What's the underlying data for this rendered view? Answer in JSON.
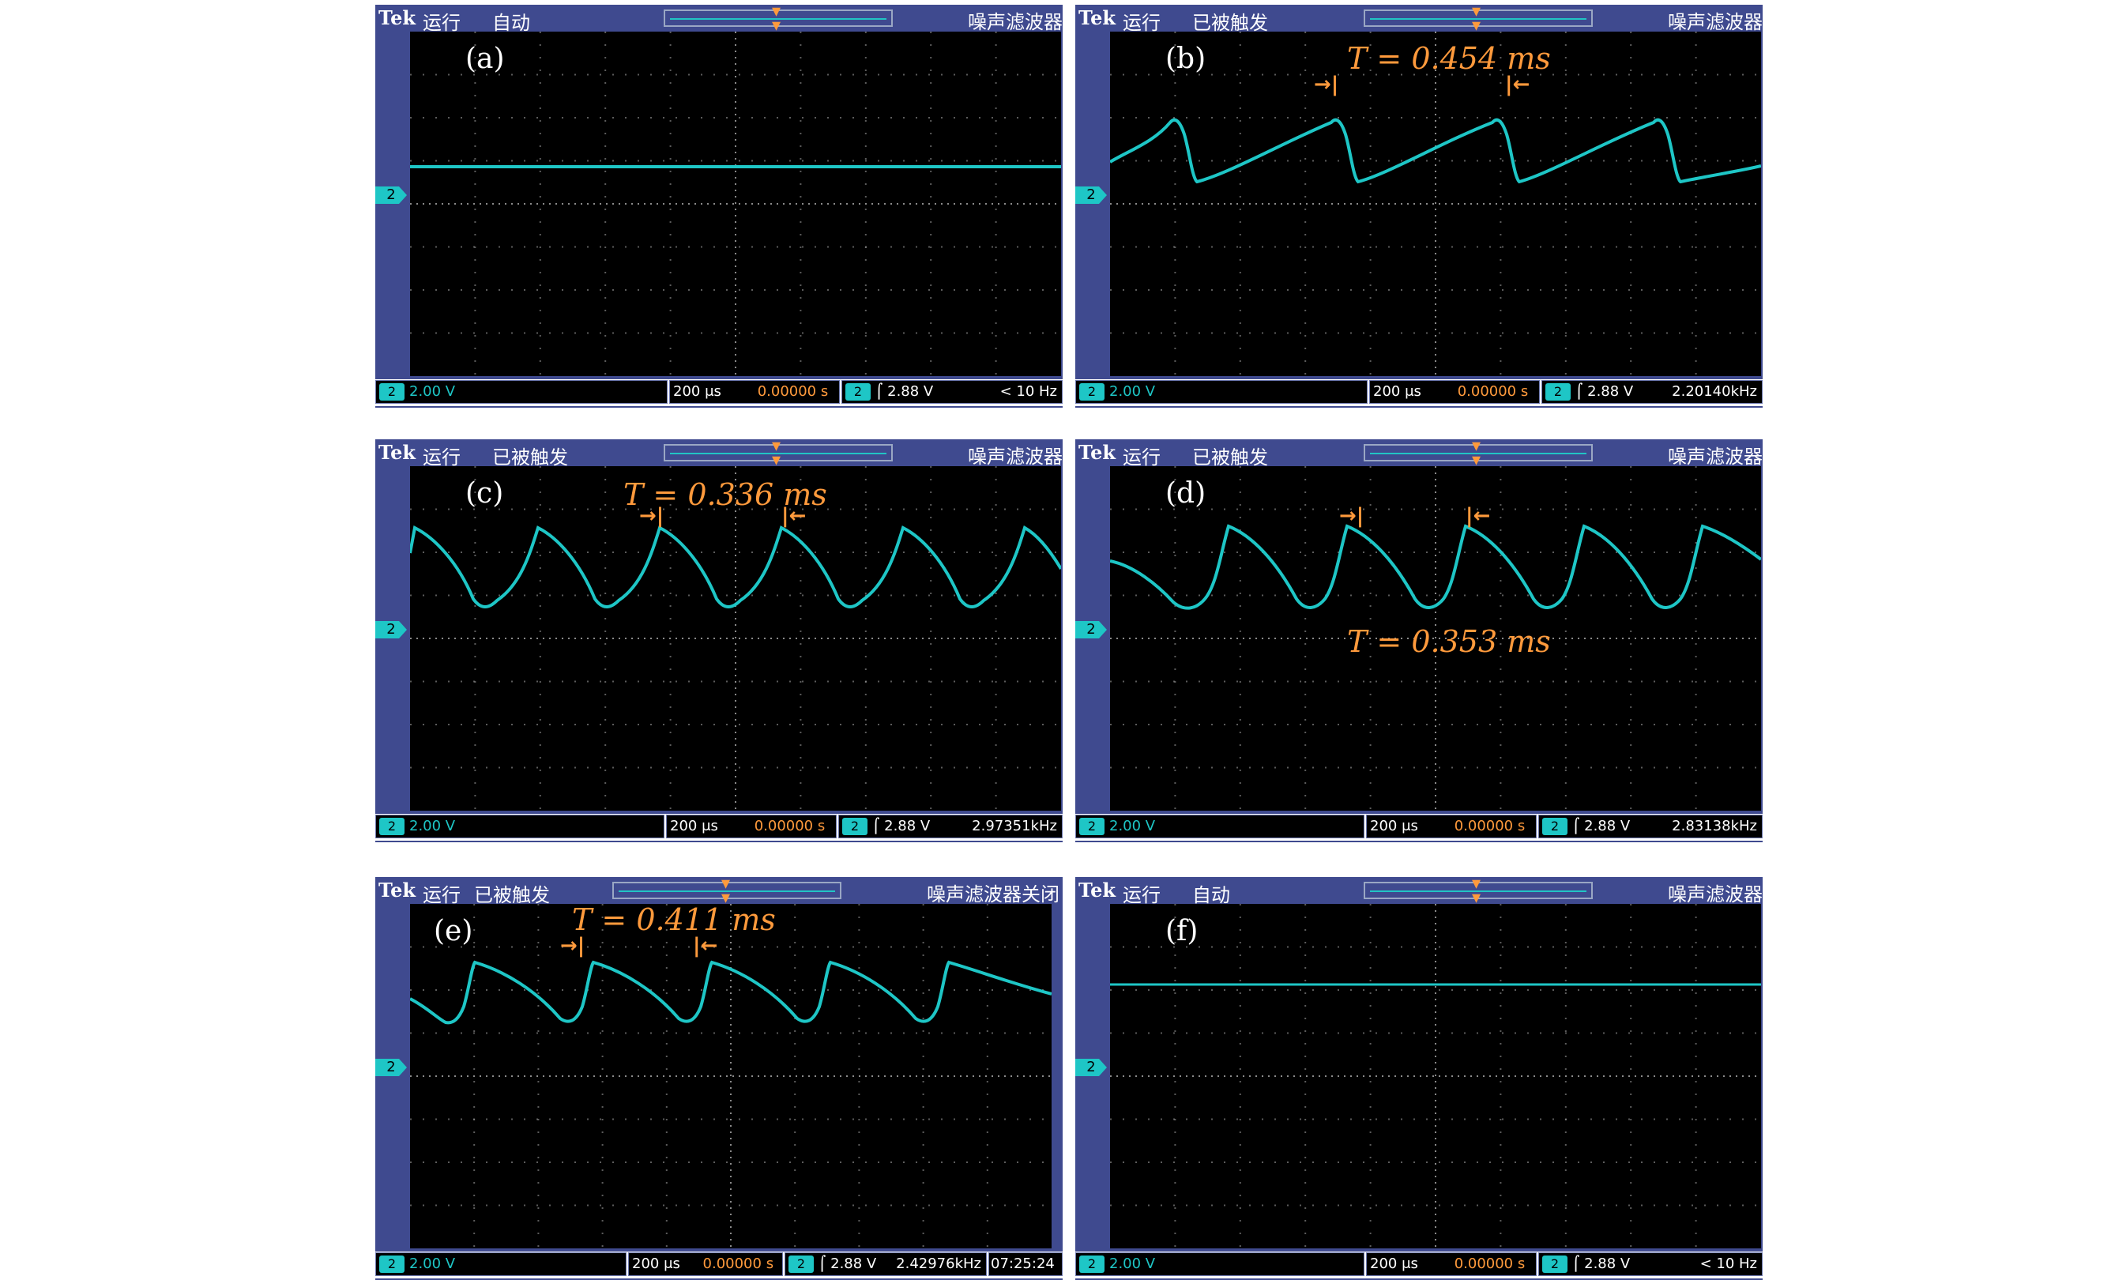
{
  "panels": [
    {
      "label": "(a)",
      "state": "运行",
      "mode": "自动",
      "filter": "噪声滤波器",
      "ch": "2",
      "volts": "2.00 V",
      "timebase": "200 μs",
      "tpos": "0.00000 s",
      "trig_ch": "2",
      "trig": "2.88 V",
      "freq": "< 10 Hz",
      "period": ""
    },
    {
      "label": "(b)",
      "state": "运行",
      "mode": "已被触发",
      "filter": "噪声滤波器",
      "ch": "2",
      "volts": "2.00 V",
      "timebase": "200 μs",
      "tpos": "0.00000 s",
      "trig_ch": "2",
      "trig": "2.88 V",
      "freq": "2.20140kHz",
      "period": "T = 0.454 ms"
    },
    {
      "label": "(c)",
      "state": "运行",
      "mode": "已被触发",
      "filter": "噪声滤波器",
      "ch": "2",
      "volts": "2.00 V",
      "timebase": "200 μs",
      "tpos": "0.00000 s",
      "trig_ch": "2",
      "trig": "2.88 V",
      "freq": "2.97351kHz",
      "period": "T = 0.336 ms"
    },
    {
      "label": "(d)",
      "state": "运行",
      "mode": "已被触发",
      "filter": "噪声滤波器",
      "ch": "2",
      "volts": "2.00 V",
      "timebase": "200 μs",
      "tpos": "0.00000 s",
      "trig_ch": "2",
      "trig": "2.88 V",
      "freq": "2.83138kHz",
      "period": "T = 0.353 ms"
    },
    {
      "label": "(e)",
      "state": "运行",
      "mode": "已被触发",
      "filter": "噪声滤波器关闭",
      "ch": "2",
      "volts": "2.00 V",
      "timebase": "200 μs",
      "tpos": "0.00000 s",
      "trig_ch": "2",
      "trig": "2.88 V",
      "freq": "2.42976kHz",
      "clock": "07:25:24",
      "period": "T = 0.411 ms"
    },
    {
      "label": "(f)",
      "state": "运行",
      "mode": "自动",
      "filter": "噪声滤波器",
      "ch": "2",
      "volts": "2.00 V",
      "timebase": "200 μs",
      "tpos": "0.00000 s",
      "trig_ch": "2",
      "trig": "2.88 V",
      "freq": "< 10 Hz",
      "period": ""
    }
  ],
  "brand": "Tek",
  "colors": {
    "trace": "#1ec6c6",
    "annotation": "#ff9a3c",
    "frame": "#3f4a8f"
  }
}
